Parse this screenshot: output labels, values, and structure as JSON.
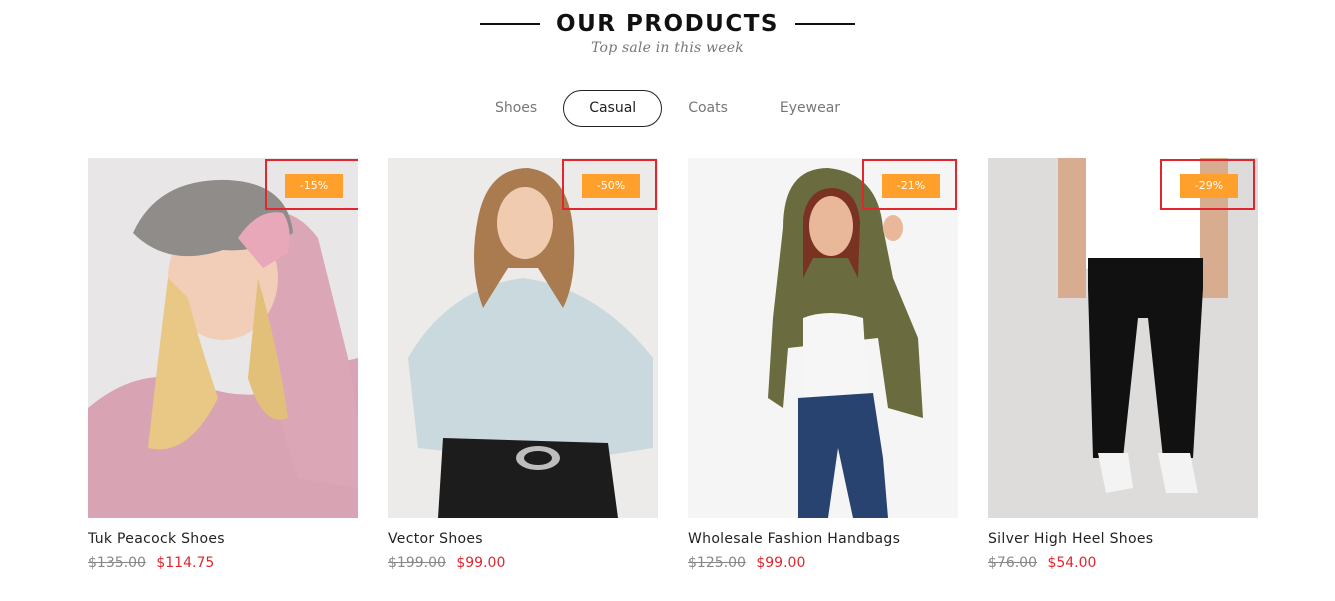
{
  "section": {
    "title": "OUR PRODUCTS",
    "subtitle": "Top sale in this week"
  },
  "tabs": [
    {
      "label": "Shoes",
      "active": false
    },
    {
      "label": "Casual",
      "active": true
    },
    {
      "label": "Coats",
      "active": false
    },
    {
      "label": "Eyewear",
      "active": false
    }
  ],
  "products": [
    {
      "name": "Tuk Peacock Shoes",
      "old_price": "$135.00",
      "new_price": "$114.75",
      "discount": "-15%"
    },
    {
      "name": "Vector Shoes",
      "old_price": "$199.00",
      "new_price": "$99.00",
      "discount": "-50%"
    },
    {
      "name": "Wholesale Fashion Handbags",
      "old_price": "$125.00",
      "new_price": "$99.00",
      "discount": "-21%"
    },
    {
      "name": "Silver High Heel Shoes",
      "old_price": "$76.00",
      "new_price": "$54.00",
      "discount": "-29%"
    }
  ],
  "colors": {
    "badge": "#ff9f2c",
    "sale_price": "#e1262d",
    "highlight_box": "#e1262d"
  }
}
